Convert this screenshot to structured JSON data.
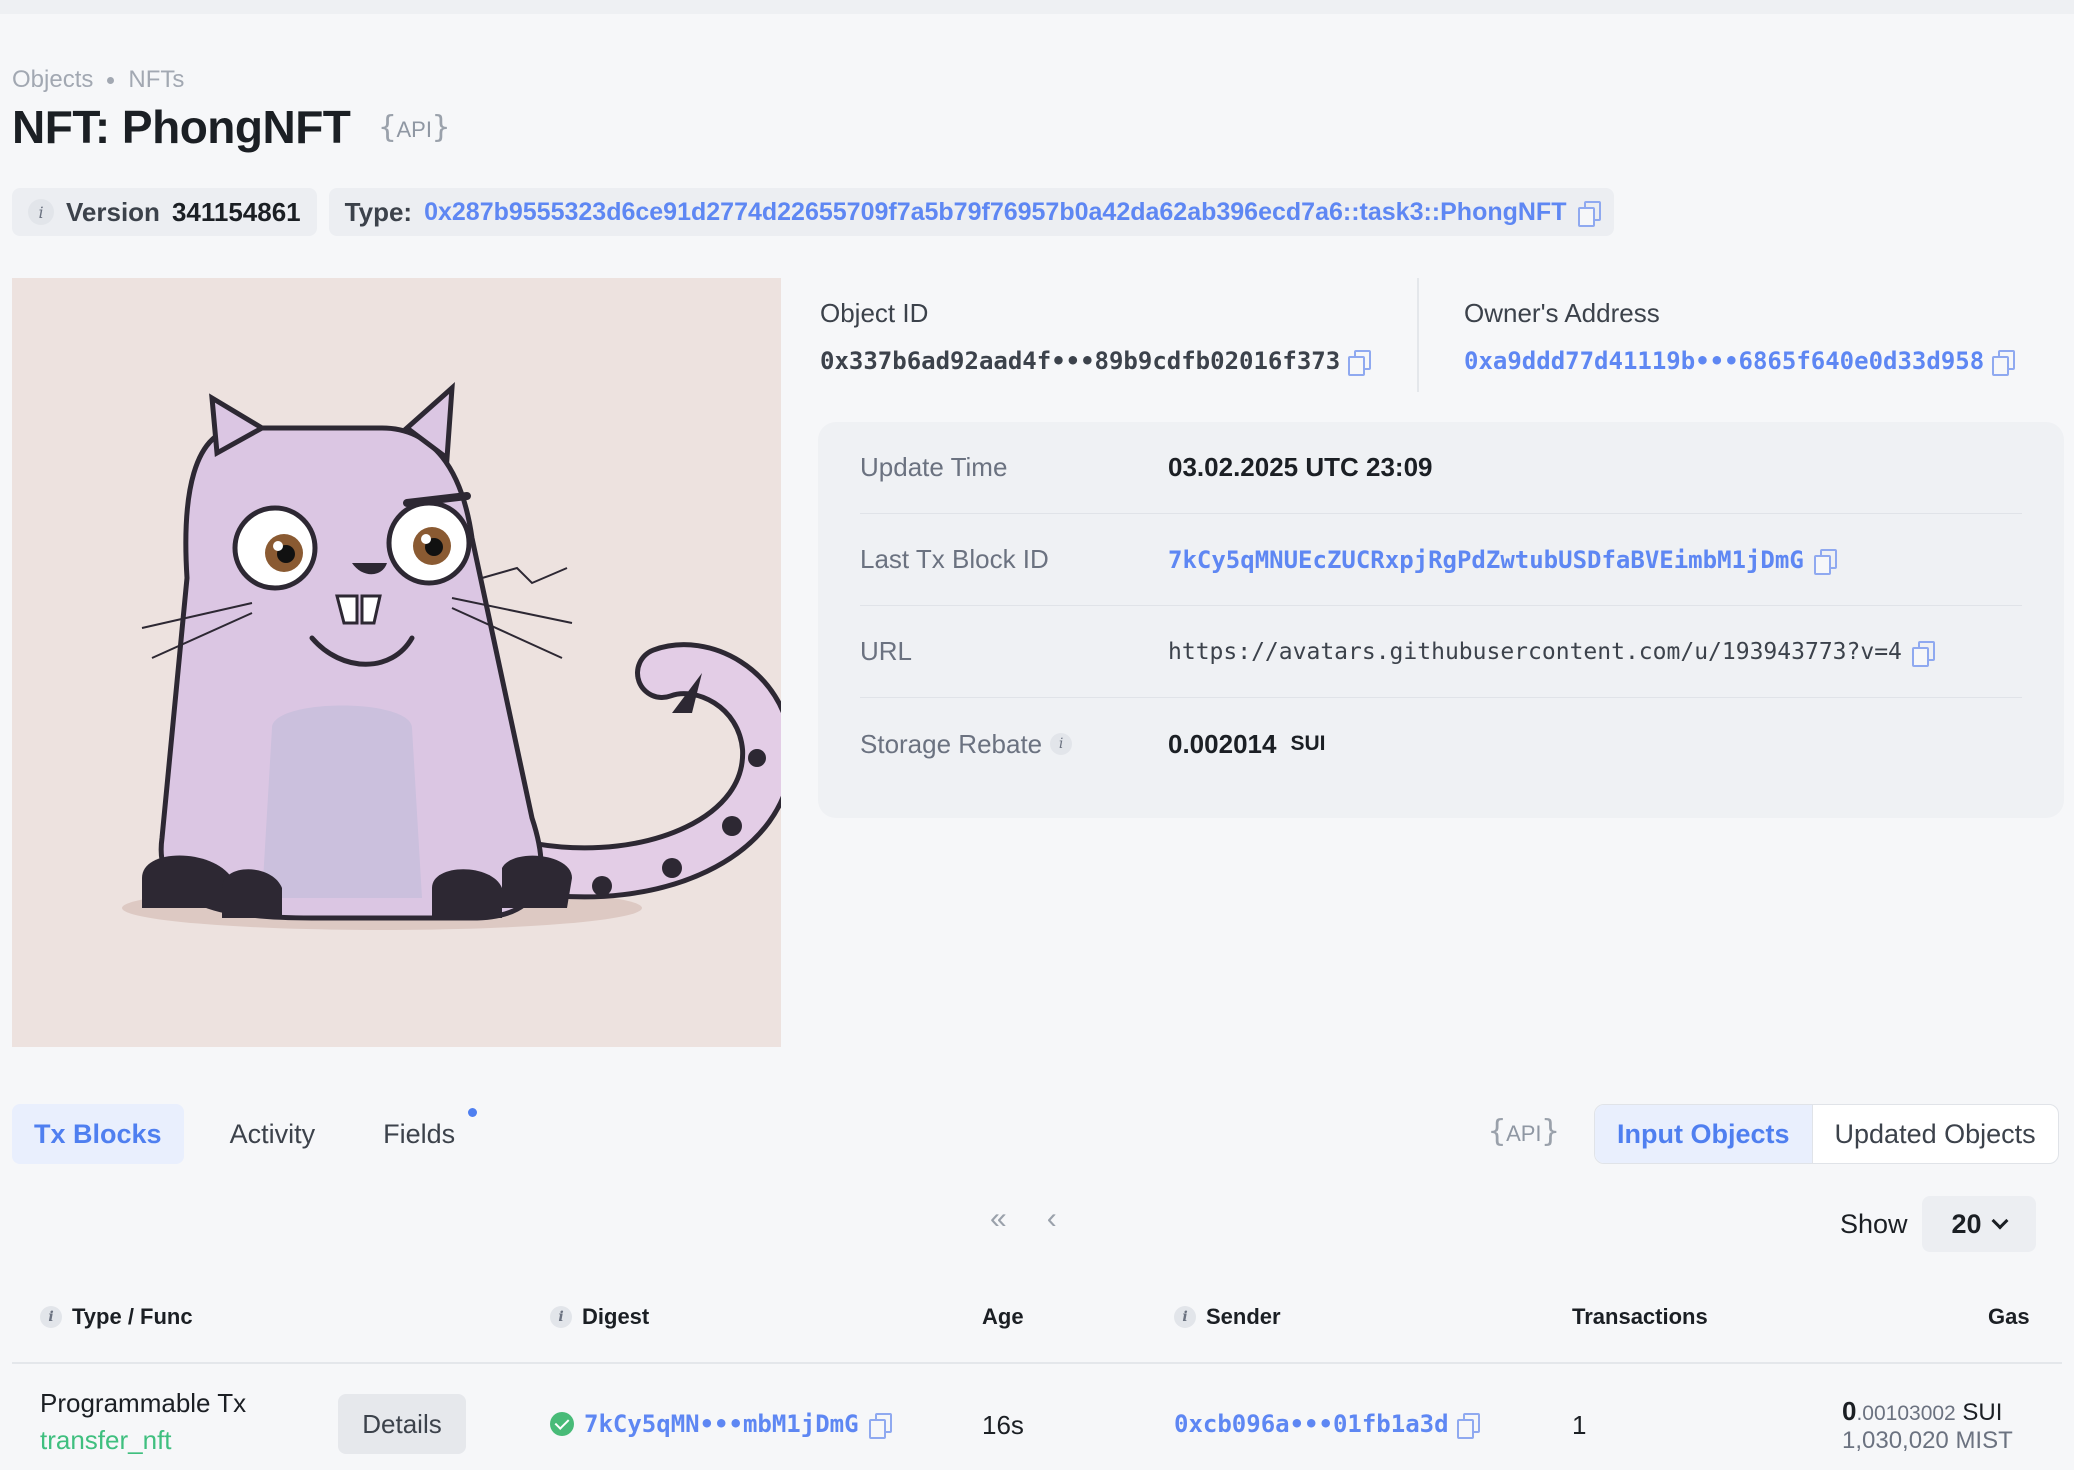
{
  "breadcrumb": {
    "objects": "Objects",
    "nfts": "NFTs"
  },
  "page": {
    "title": "NFT: PhongNFT",
    "api_label": "API"
  },
  "meta": {
    "version_label": "Version",
    "version_value": "341154861",
    "type_label": "Type:",
    "type_value": "0x287b9555323d6ce91d2774d22655709f7a5b79f76957b0a42da62ab396ecd7a6::task3::PhongNFT"
  },
  "object": {
    "id_label": "Object ID",
    "id_value": "0x337b6ad92aad4f•••89b9cdfb02016f373",
    "owner_label": "Owner's Address",
    "owner_value": "0xa9ddd77d41119b•••6865f640e0d33d958"
  },
  "details": {
    "update_time_label": "Update Time",
    "update_time_value": "03.02.2025 UTC 23:09",
    "last_tx_label": "Last Tx Block ID",
    "last_tx_value": "7kCy5qMNUEcZUCRxpjRgPdZwtubUSDfaBVEimbM1jDmG",
    "url_label": "URL",
    "url_value": "https://avatars.githubusercontent.com/u/193943773?v=4",
    "storage_label": "Storage Rebate",
    "storage_value": "0.002014",
    "storage_unit": "SUI"
  },
  "tabs": {
    "tx_blocks": "Tx Blocks",
    "activity": "Activity",
    "fields": "Fields"
  },
  "filter": {
    "api_label": "API",
    "input_objects": "Input Objects",
    "updated_objects": "Updated Objects"
  },
  "pagination": {
    "first": "«",
    "prev": "‹",
    "show_label": "Show",
    "page_size": "20"
  },
  "table": {
    "headers": {
      "type_func": "Type / Func",
      "digest": "Digest",
      "age": "Age",
      "sender": "Sender",
      "transactions": "Transactions",
      "gas": "Gas"
    },
    "rows": [
      {
        "type": "Programmable Tx",
        "func": "transfer_nft",
        "details": "Details",
        "digest": "7kCy5qMN•••mbM1jDmG",
        "age": "16s",
        "sender": "0xcb096a•••01fb1a3d",
        "transactions": "1",
        "gas_int": "0",
        "gas_dec": ".00103002",
        "gas_unit": "SUI",
        "gas_mist": "1,030,020 MIST"
      }
    ]
  },
  "colors": {
    "accent": "#5e87f3",
    "success": "#3fbf7f",
    "card_bg": "#eff1f4"
  }
}
